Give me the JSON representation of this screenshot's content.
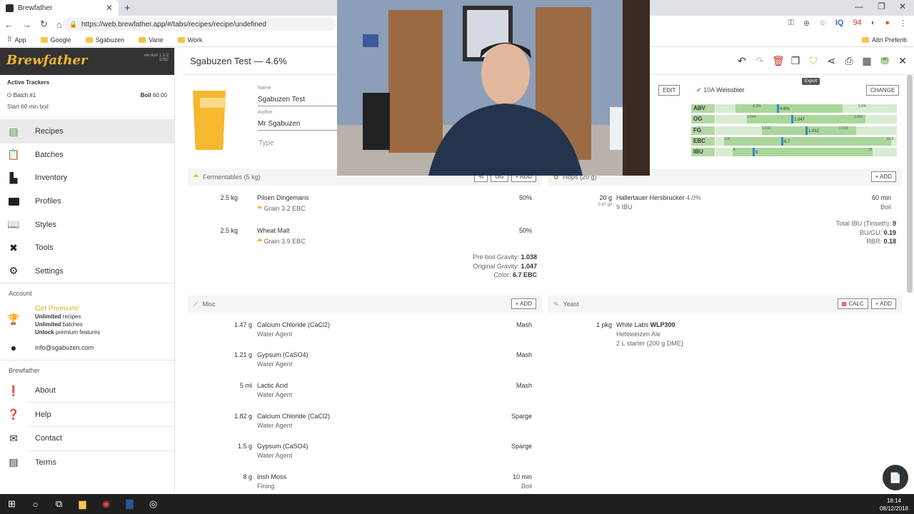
{
  "browser": {
    "tab_title": "Brewfather",
    "url": "https://web.brewfather.app/#/tabs/recipes/recipe/undefined",
    "bookmarks": [
      "App",
      "Google",
      "Sgabuzen",
      "Varie",
      "Work"
    ],
    "other_bookmarks": "Altri Preferiti",
    "ext_badge": "94"
  },
  "sidebar": {
    "logo": "Brewfather",
    "version": "version 1.3.2",
    "version_sub": "1082",
    "trackers_title": "Active Trackers",
    "batch": "Batch #1",
    "boil_label": "Boil",
    "boil_time": "60:00",
    "start_text": "Start 60 min boil",
    "nav": [
      {
        "label": "Recipes",
        "icon": "recipes-icon"
      },
      {
        "label": "Batches",
        "icon": "batches-icon"
      },
      {
        "label": "Inventory",
        "icon": "inventory-icon"
      },
      {
        "label": "Profiles",
        "icon": "profiles-icon"
      },
      {
        "label": "Styles",
        "icon": "styles-icon"
      },
      {
        "label": "Tools",
        "icon": "tools-icon"
      },
      {
        "label": "Settings",
        "icon": "settings-icon"
      }
    ],
    "account_title": "Account",
    "premium_title": "Get Premium!",
    "premium_1b": "Unlimited",
    "premium_1": " recipes",
    "premium_2b": "Unlimited",
    "premium_2": " batches",
    "premium_3b": "Unlock",
    "premium_3": " premium features",
    "email": "info@sgabuzen.com",
    "brewfather_title": "Brewfather",
    "nav2": [
      {
        "label": "About"
      },
      {
        "label": "Help"
      },
      {
        "label": "Contact"
      },
      {
        "label": "Terms"
      }
    ]
  },
  "recipe": {
    "title": "Sgabuzen Test — 4.6%",
    "name_label": "Name",
    "name": "Sgabuzen Test",
    "author_label": "Author",
    "author": "Mr Sgabuzen",
    "type_placeholder": "Type",
    "edit": "EDIT",
    "style_code": "10A",
    "style_name": "Weissbier",
    "change": "CHANGE",
    "export_tooltip": "Export"
  },
  "style_bars": [
    {
      "name": "ABV",
      "min": "4.3%",
      "max": "5.6%",
      "value": "4.6%"
    },
    {
      "name": "OG",
      "min": "1.044",
      "max": "1.052",
      "value": "1.047"
    },
    {
      "name": "FG",
      "min": "1.010",
      "max": "1.014",
      "value": "1.012"
    },
    {
      "name": "EBC",
      "min": "3.9",
      "max": "11.8",
      "value": "6.7"
    },
    {
      "name": "IBU",
      "min": "8",
      "max": "15",
      "value": "9"
    }
  ],
  "fermentables": {
    "title": "Fermentables (5 kg)",
    "btn_pct": "%",
    "btn_og": "OG",
    "add": "+ ADD",
    "items": [
      {
        "amount": "2.5 kg",
        "name": "Pilsen",
        "brand": "Dingemans",
        "pct": "50%",
        "type": "Grain",
        "color": "3.2 EBC"
      },
      {
        "amount": "2.5 kg",
        "name": "Wheat Malt",
        "brand": "",
        "pct": "50%",
        "type": "Grain",
        "color": "3.9 EBC"
      }
    ],
    "preboil_label": "Pre-boil Gravity:",
    "preboil": "1.038",
    "og_label": "Original Gravity:",
    "og": "1.047",
    "color_label": "Color:",
    "color": "6.7 EBC"
  },
  "hops": {
    "title": "Hops (20 g)",
    "add": "+ ADD",
    "items": [
      {
        "amount": "20 g",
        "perl": "0.87 g/l",
        "name": "Hallertauer Hersbrucker",
        "alpha": "4.0%",
        "ibu": "9 IBU",
        "time": "60 min",
        "use": "Boil"
      }
    ],
    "total_ibu_label": "Total IBU (Tinseth):",
    "total_ibu": "9",
    "bugu_label": "BU/GU:",
    "bugu": "0.19",
    "rbr_label": "RBR:",
    "rbr": "0.18"
  },
  "misc": {
    "title": "Misc",
    "add": "+ ADD",
    "items": [
      {
        "amount": "1.47 g",
        "name": "Calcium Chloride (CaCl2)",
        "type": "Water Agent",
        "use": "Mash",
        "time": ""
      },
      {
        "amount": "1.21 g",
        "name": "Gypsum (CaSO4)",
        "type": "Water Agent",
        "use": "Mash",
        "time": ""
      },
      {
        "amount": "5 ml",
        "name": "Lactic Acid",
        "type": "Water Agent",
        "use": "Mash",
        "time": ""
      },
      {
        "amount": "1.82 g",
        "name": "Calcium Chloride (CaCl2)",
        "type": "Water Agent",
        "use": "Sparge",
        "time": ""
      },
      {
        "amount": "1.5 g",
        "name": "Gypsum (CaSO4)",
        "type": "Water Agent",
        "use": "Sparge",
        "time": ""
      },
      {
        "amount": "8 g",
        "name": "Irish Moss",
        "type": "Fining",
        "use": "Boil",
        "time": "10 min"
      }
    ]
  },
  "yeast": {
    "title": "Yeast",
    "calc": "CALC",
    "add": "+ ADD",
    "amount": "1 pkg",
    "lab": "White Labs",
    "code": "WLP300",
    "name": "Hefeweizen Ale",
    "starter": "2 L starter (200 g DME)"
  },
  "taskbar": {
    "time": "18:14",
    "date": "08/12/2018"
  }
}
